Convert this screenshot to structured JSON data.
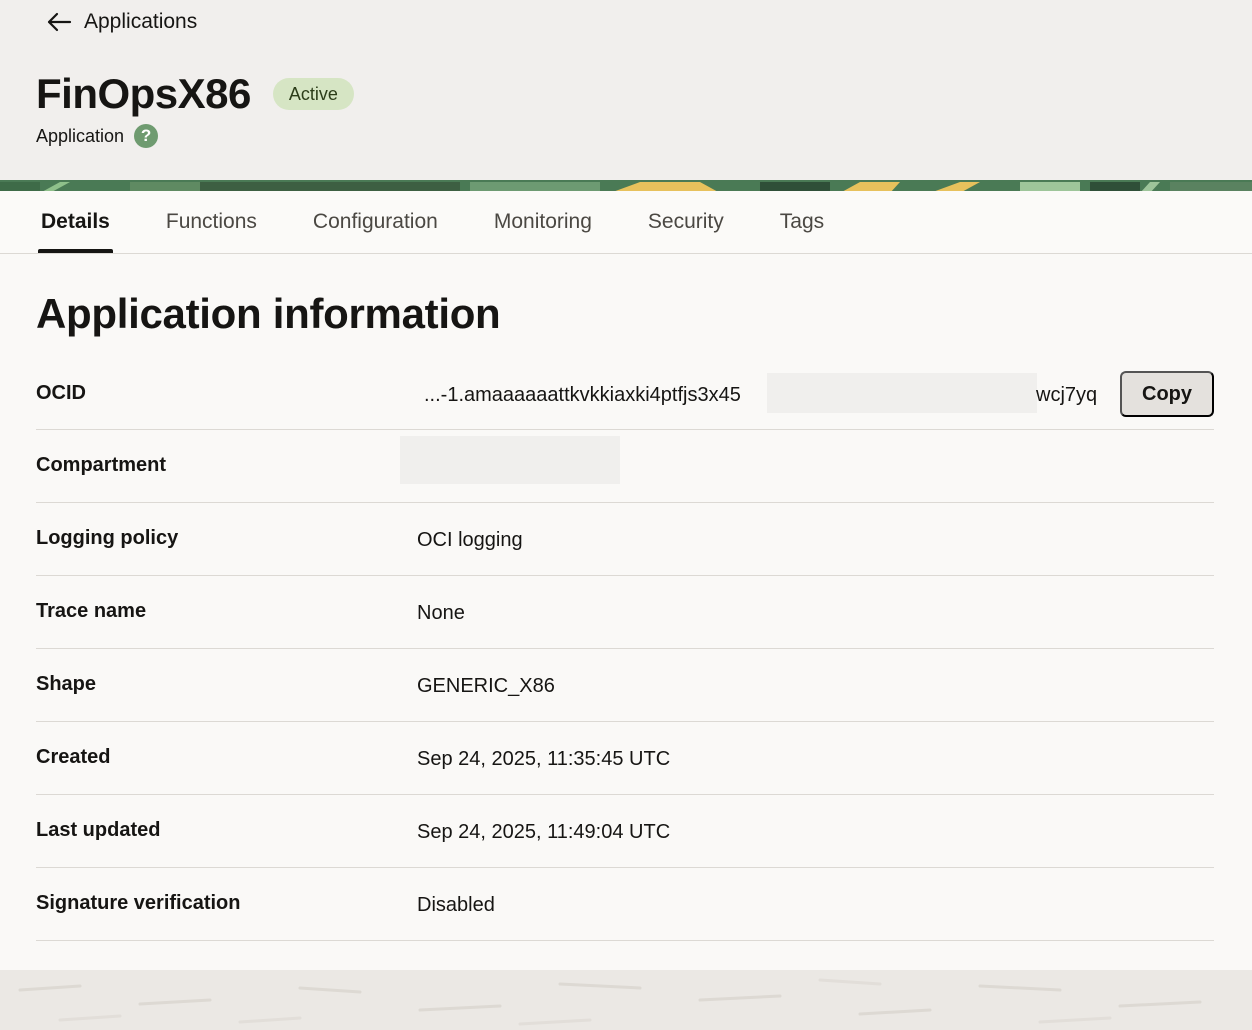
{
  "header": {
    "back_label": "Applications",
    "title": "FinOpsX86",
    "status": "Active",
    "subtitle": "Application"
  },
  "tabs": [
    {
      "label": "Details",
      "active": true
    },
    {
      "label": "Functions"
    },
    {
      "label": "Configuration"
    },
    {
      "label": "Monitoring"
    },
    {
      "label": "Security"
    },
    {
      "label": "Tags"
    }
  ],
  "info": {
    "title": "Application information",
    "ocid": {
      "label": "OCID",
      "value_prefix": "...-1.amaaaaaattkvkkiaxki4ptfjs3x45",
      "value_suffix": "wcj7yq",
      "copy_label": "Copy"
    },
    "compartment": {
      "label": "Compartment",
      "value": ""
    },
    "logging_policy": {
      "label": "Logging policy",
      "value": "OCI logging"
    },
    "trace_name": {
      "label": "Trace name",
      "value": "None"
    },
    "shape": {
      "label": "Shape",
      "value": "GENERIC_X86"
    },
    "created": {
      "label": "Created",
      "value": "Sep 24, 2025, 11:35:45 UTC"
    },
    "last_updated": {
      "label": "Last updated",
      "value": "Sep 24, 2025, 11:49:04 UTC"
    },
    "signature_verification": {
      "label": "Signature verification",
      "value": "Disabled"
    }
  },
  "icons": {
    "back": "arrow-left-icon",
    "help": "help-icon"
  },
  "colors": {
    "status_badge_bg": "#d6e5c4",
    "help_icon": "#6f9b70",
    "banner": "#4a7a55",
    "accent_yellow": "#e7c15c"
  }
}
